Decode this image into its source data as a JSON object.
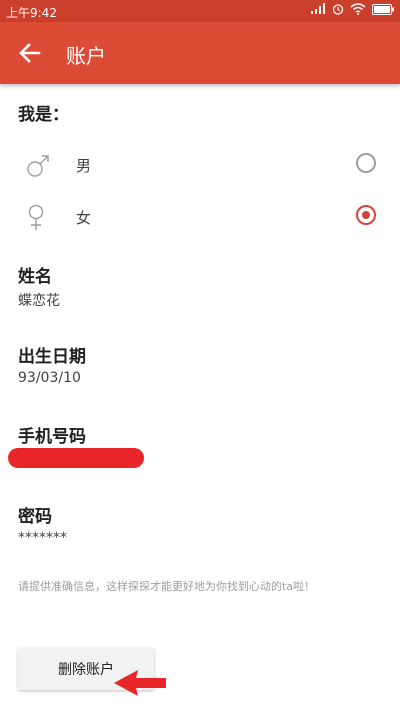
{
  "status_bar": {
    "time": "上午9:42"
  },
  "app_bar": {
    "title": "账户"
  },
  "gender": {
    "label": "我是：",
    "options": [
      {
        "label": "男",
        "selected": false
      },
      {
        "label": "女",
        "selected": true
      }
    ]
  },
  "fields": {
    "name": {
      "label": "姓名",
      "value": "蝶恋花"
    },
    "birthday": {
      "label": "出生日期",
      "value": "93/03/10"
    },
    "phone": {
      "label": "手机号码",
      "value": ""
    },
    "password": {
      "label": "密码",
      "value": "*******"
    }
  },
  "hint": "请提供准确信息，这样探探才能更好地为你找到心动的ta啦！",
  "delete_button": {
    "label": "删除账户"
  },
  "colors": {
    "status_bar": "#ca3f2b",
    "app_bar": "#dc4b36",
    "radio_checked": "#d0453b",
    "annotation_red": "#e8262a"
  },
  "icons": {
    "back": "arrow-left-icon",
    "male": "male-symbol-icon",
    "female": "female-symbol-icon"
  }
}
